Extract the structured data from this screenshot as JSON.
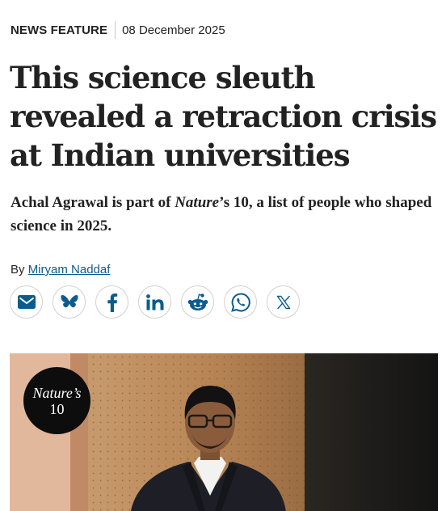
{
  "article": {
    "type": "NEWS FEATURE",
    "date": "08 December 2025",
    "headline": "This science sleuth revealed a retraction crisis at Indian universities",
    "standfirst": {
      "before": "Achal Agrawal is part of ",
      "italic": "Nature",
      "after": "’s 10, a list of people who shaped science in 2025."
    },
    "byline": {
      "prefix": "By ",
      "author": "Miryam Naddaf"
    }
  },
  "share": {
    "buttons": [
      {
        "icon": "email-icon"
      },
      {
        "icon": "bluesky-icon"
      },
      {
        "icon": "facebook-icon"
      },
      {
        "icon": "linkedin-icon"
      },
      {
        "icon": "reddit-icon"
      },
      {
        "icon": "whatsapp-icon"
      },
      {
        "icon": "x-icon"
      }
    ]
  },
  "hero": {
    "badge": {
      "line1": "Nature’s",
      "line2": "10"
    }
  },
  "colors": {
    "accent": "#0b5c8e",
    "text": "#222222",
    "border": "#d2d2d2"
  }
}
